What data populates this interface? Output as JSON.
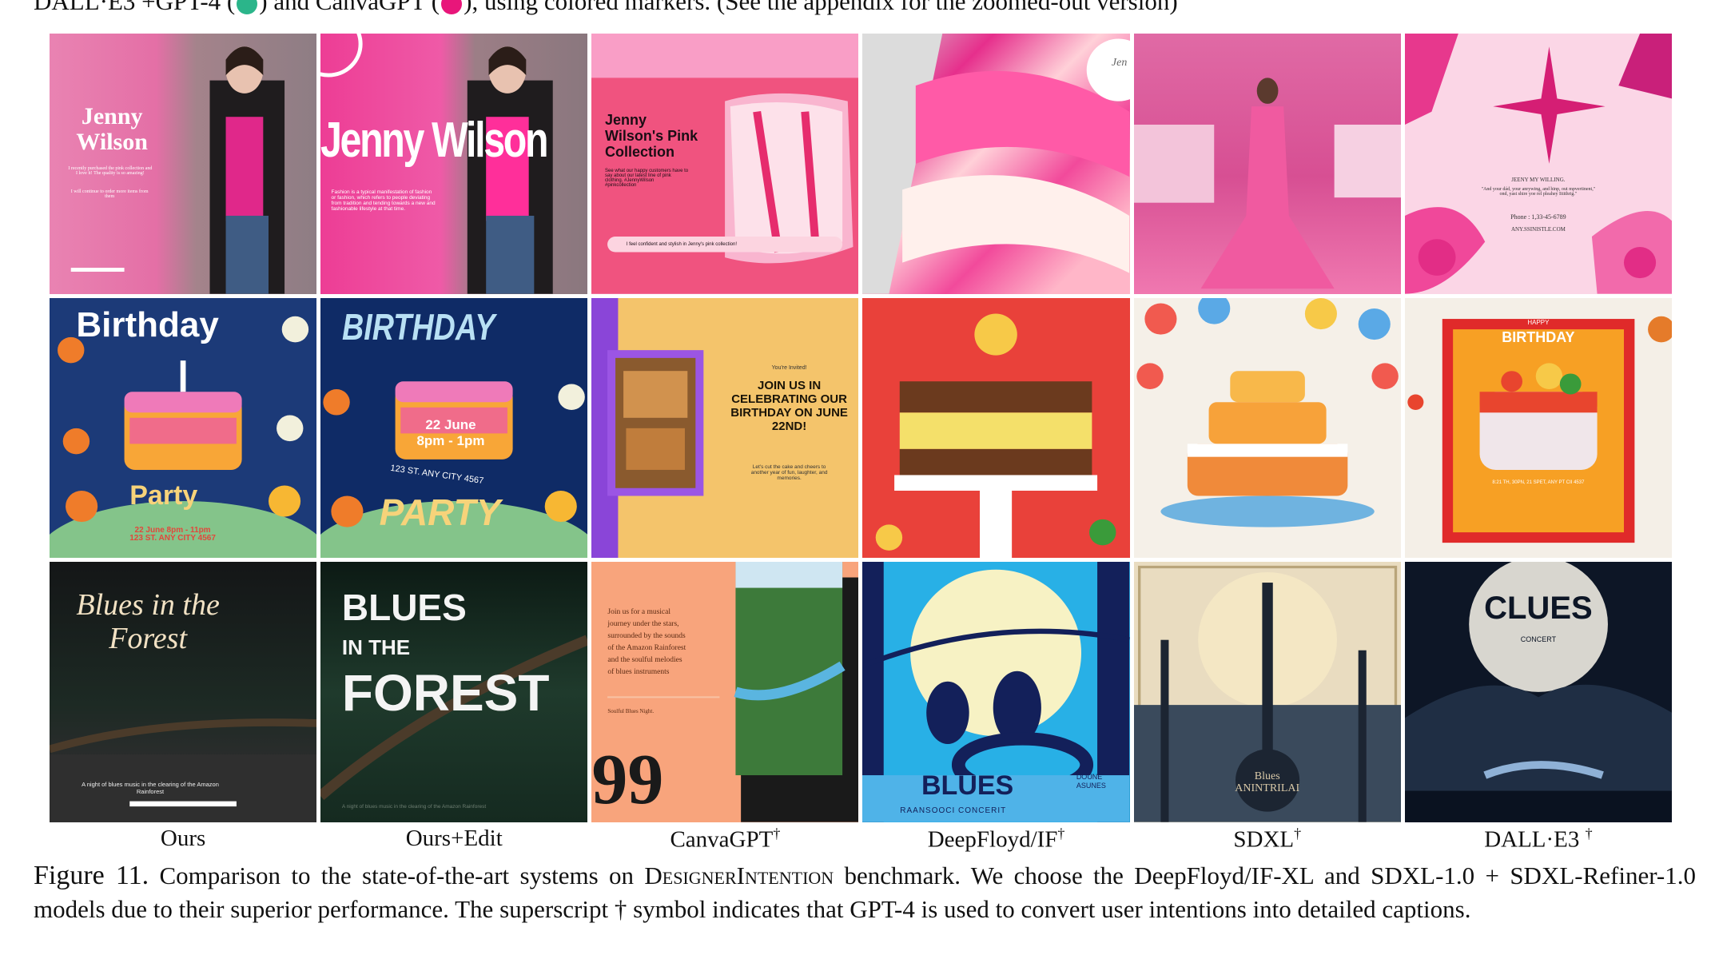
{
  "top_text": {
    "part1": "DALL·E3 +GPT-4 (",
    "part2": ") and CanvaGPT (",
    "part3": "), using colored markers. (See the appendix for the zoomed-out version)",
    "marker1_color": "#2bb58a",
    "marker2_color": "#e8167a"
  },
  "cells": {
    "r1c1": {
      "title": "Jenny\nWilson",
      "body": "I recently purchased the pink collection and\nI love it! The quality is so amazing!",
      "body2": "I will continue to order more items from\nthem"
    },
    "r1c2": {
      "title": "Jenny Wilson",
      "body": "Fashion is a typical manifestation of fashion\nor fashion, which refers to people deviating\nfrom tradition and tending towards a new and\nfashionable lifestyle at that time."
    },
    "r1c3": {
      "title": "Jenny\nWilson's Pink\nCollection",
      "body": "See what our happy customers have to\nsay about our latest line of pink\nclothing. #JennyWilson\n#pinkcollection",
      "pill": "I feel confident and stylish in Jenny's pink collection!"
    },
    "r1c4": {
      "script": "Jen"
    },
    "r1c6": {
      "name": "JEENY MY WILLING.",
      "quote": "\"And your dád, your anrywing, and hinp, out mpvertinent,\"\nond, yast shire yoe rel pleahey Iitithrig.\"",
      "phone": "Phone : 1,33-45-6789",
      "site": "ANY.SSINISTLE.COM"
    },
    "r2c1": {
      "top": "Birthday",
      "bottom": "Party",
      "info": "22 June 8pm - 11pm\n123 ST. ANY CITY 4567"
    },
    "r2c2": {
      "top": "BIRTHDAY",
      "date": "22 June\n8pm - 1pm",
      "addr": "123 ST. ANY CITY 4567",
      "bottom": "PARTY"
    },
    "r2c3": {
      "invited": "You're Invited!",
      "headline": "JOIN US IN\nCELEBRATING OUR\nBIRTHDAY ON JUNE\n22ND!",
      "body": "Let's cut the cake and cheers to\nanother year of fun, laughter, and\nmemories."
    },
    "r2c6": {
      "happy": "HAPPY",
      "birthday": "BIRTHDAY",
      "info": "8:21 TH, 30PN, 21 SPET, ANY PT CII 4537"
    },
    "r3c1": {
      "title": "Blues in the\nForest",
      "footer": "A night of blues music in the clearing of the Amazon\nRainforest"
    },
    "r3c2": {
      "title1": "BLUES",
      "title2": "IN THE",
      "title3": "FOREST",
      "footer": "A night of blues music in the clearing of the Amazon Rainforest"
    },
    "r3c3": {
      "body": "Join us for a musical\njourney under the stars,\nsurrounded by the sounds\nof the Amazon Rainforest\nand the soulful melodies\nof blues instruments",
      "small": "Soulful Blues Night.",
      "quote": "99"
    },
    "r3c4": {
      "title": "BLUES",
      "side": "DOUNE\nASUNES",
      "sub": "RAANSOOCI CONCERIT"
    },
    "r3c5": {
      "title": "Blues\nANINTRILAI"
    },
    "r3c6": {
      "title": "CLUES",
      "sub": "CONCERT"
    }
  },
  "labels": [
    "Ours",
    "Ours+Edit",
    "CanvaGPT",
    "DeepFloyd/IF",
    "SDXL",
    "DALL·E3"
  ],
  "label_dagger": "†",
  "caption": {
    "fig": "Figure 11.",
    "p1": " Comparison to the state-of-the-art systems on ",
    "bench": "DesignerIntention",
    "p2": " benchmark. We choose the DeepFloyd/IF-XL and SDXL-1.0 + SDXL-Refiner-1.0 models due to their superior performance. The superscript † symbol indicates that GPT-4 is used to convert user intentions into detailed captions."
  }
}
